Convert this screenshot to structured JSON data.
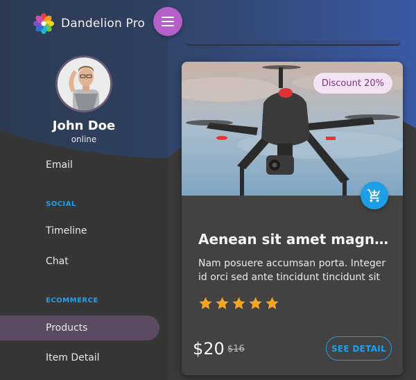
{
  "app": {
    "name": "Dandelion Pro"
  },
  "user": {
    "name": "John Doe",
    "status": "online"
  },
  "sidebar": {
    "items": [
      {
        "label": "Email"
      },
      {
        "label": "Timeline"
      },
      {
        "label": "Chat"
      },
      {
        "label": "Products",
        "active": true
      },
      {
        "label": "Item Detail"
      }
    ],
    "sections": [
      {
        "label": "SOCIAL"
      },
      {
        "label": "ECOMMERCE"
      }
    ]
  },
  "product": {
    "discount": "Discount 20%",
    "title": "Aenean sit amet magna v...",
    "description": "Nam posuere accumsan porta. Integer id orci sed ante tincidunt tincidunt sit amet",
    "rating": 5,
    "price": "$20",
    "old_price": "$16",
    "detail_label": "SEE DETAIL"
  },
  "colors": {
    "accent_purple": "#b55fc9",
    "accent_blue": "#1e9ee6",
    "star": "#f5a623"
  },
  "icons": [
    "dandelion-logo-icon",
    "menu-icon",
    "add-to-cart-icon",
    "star-icon"
  ]
}
